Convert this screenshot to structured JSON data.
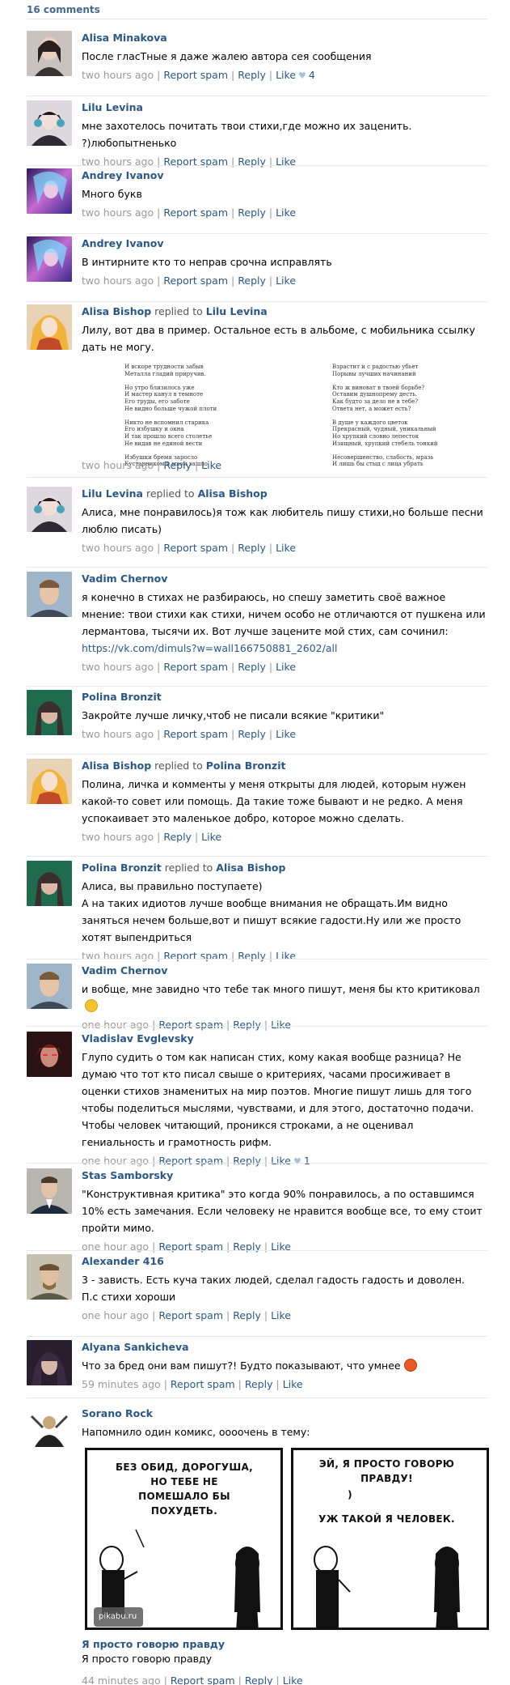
{
  "header": {
    "title": "16 comments"
  },
  "actions": {
    "report": "Report spam",
    "reply": "Reply",
    "like": "Like"
  },
  "comments": [
    {
      "author": "Alisa Minakova",
      "text": "После гласТные я даже жалею автора сея сообщения",
      "time": "two hours ago",
      "likes": "4"
    },
    {
      "author": "Lilu Levina",
      "text": "мне захотелось почитать твои стихи,где можно их заценить. ?)любопытненько",
      "time": "two hours ago"
    },
    {
      "author": "Andrey Ivanov",
      "text": "Много букв",
      "time": "two hours ago"
    },
    {
      "author": "Andrey Ivanov",
      "text": "В интирните кто то неправ срочна исправлять",
      "time": "two hours ago"
    },
    {
      "author": "Alisa Bishop",
      "replied": "replied to",
      "reply_to": "Lilu Levina",
      "text": "Лилу, вот два в пример. Остальное есть в альбоме, с мобильника ссылку дать не могу.",
      "time": "two hours ago",
      "poem_left": [
        "И вскоре трудности забыв",
        "Металла гладий приручив.",
        "",
        "Но утро близилось уже",
        "И мастер канул в темноте",
        "Его труды, его заботе",
        "Не видно больше чужой плоти",
        "",
        "Никто не вспомнил старика",
        "Его избушку и окна",
        "И так прошло всего столетье",
        "Не видав не единой вести",
        "",
        "Избушки бремя заросло",
        "Кустарником и мхом зашло"
      ],
      "poem_right": [
        "Взрастит и с радостью убьет",
        "Порывы лучших начинаний",
        "",
        "Кто ж виноват в твоей борьбе?",
        "Оставим душнопрему десть.",
        "Как будто за дело не в тебе?",
        "Ответа нет, а может есть?",
        "",
        "В душе у каждого цветок",
        "Прекрасный, чудный, уникальный",
        "Но хрупкий словно лепесток",
        "Изящный, хрупкий стебель тонкий",
        "",
        "Несовершенство, слабость, мразь",
        "И лишь бы стыд с лица убрать"
      ]
    },
    {
      "author": "Lilu Levina",
      "replied": "replied to",
      "reply_to": "Alisa Bishop",
      "text": "Алиса, мне понравилось)я тож как любитель пишу стихи,но больше песни люблю писать)",
      "time": "two hours ago"
    },
    {
      "author": "Vadim Chernov",
      "text": "я конечно в стихах не разбираюсь, но спешу заметить своё важное мнение: твои стихи как стихи, ничем особо не отличаются от пушкена или лермантова, тысячи их. Вот лучше зацените мой стих, сам сочинил: ",
      "link": "https://vk.com/dimuls?w=wall166750881_2602/all",
      "time": "two hours ago"
    },
    {
      "author": "Polina Bronzit",
      "text": "Закройте лучше личку,чтоб не писали всякие \"критики\"",
      "time": "two hours ago"
    },
    {
      "author": "Alisa Bishop",
      "replied": "replied to",
      "reply_to": "Polina Bronzit",
      "text": "Полина, личка и комменты у меня открыты для людей, которым нужен какой-то совет или помощь. Да такие тоже бывают и не редко. А меня успокаивает это маленькое добро, которое можно сделать.",
      "time": "two hours ago"
    },
    {
      "author": "Polina Bronzit",
      "replied": "replied to",
      "reply_to": "Alisa Bishop",
      "text": "Алиса, вы правильно поступаете)\nА на таких идиотов лучше вообще внимания не обращать.Им видно заняться нечем больше,вот и пишут всякие гадости.Ну или же просто хотят выпендриться",
      "time": "two hours ago"
    },
    {
      "author": "Vadim Chernov",
      "text": "и вобще, мне завидно что тебе так много пишут, меня бы кто критиковал",
      "time": "one hour ago",
      "emoji": "sad"
    },
    {
      "author": "Vladislav Evglevsky",
      "text": "Глупо судить о том как написан стих, кому какая вообще разница? Не думаю что тот кто писал свыше о критериях, часами просиживает в оценки стихов знаменитых на мир поэтов. Многие пишут лишь для того чтобы поделиться мыслями, чувствами, и для этого, достаточно подачи. Чтобы человек читающий, проникся строками, а не оценивал гениальность и грамотность рифм.",
      "time": "one hour ago",
      "likes": "1"
    },
    {
      "author": "Stas Samborsky",
      "text": "\"Конструктивная критика\" это когда 90% понравилось, а по оставшимся 10% есть замечания. Если человеку не нравится вообще все, то ему стоит пройти мимо.",
      "time": "one hour ago"
    },
    {
      "author": "Alexander 416",
      "text": "3 - зависть. Есть куча таких людей, сделал гадость гадость и доволен.\nП.с стихи хороши",
      "time": "one hour ago"
    },
    {
      "author": "Alyana Sankicheva",
      "text": "Что за бред они вам пишут?! Будто показывают, что умнее",
      "time": "59 minutes ago",
      "emoji": "angry"
    },
    {
      "author": "Sorano Rock",
      "text": "Напомнило один комикс, оооочень в тему:",
      "time": "44 minutes ago"
    }
  ],
  "comic": {
    "panel1_text": "БЕЗ ОБИД, ДОРОГУША,\nНО ТЕБЕ НЕ\nПОМЕШАЛО БЫ\nПОХУДЕТЬ.",
    "panel2_top": "ЭЙ, Я ПРОСТО ГОВОРЮ\nПРАВДУ!",
    "panel2_paren": ")",
    "panel2_bottom": "УЖ ТАКОЙ Я ЧЕЛОВЕК.",
    "watermark": "pikabu.ru",
    "caption_link": "Я просто говорю правду",
    "caption_text": "Я просто говорю правду"
  },
  "colors": {
    "link": "#2b5788",
    "meta": "#999999",
    "separator": "#e7e8ec"
  }
}
